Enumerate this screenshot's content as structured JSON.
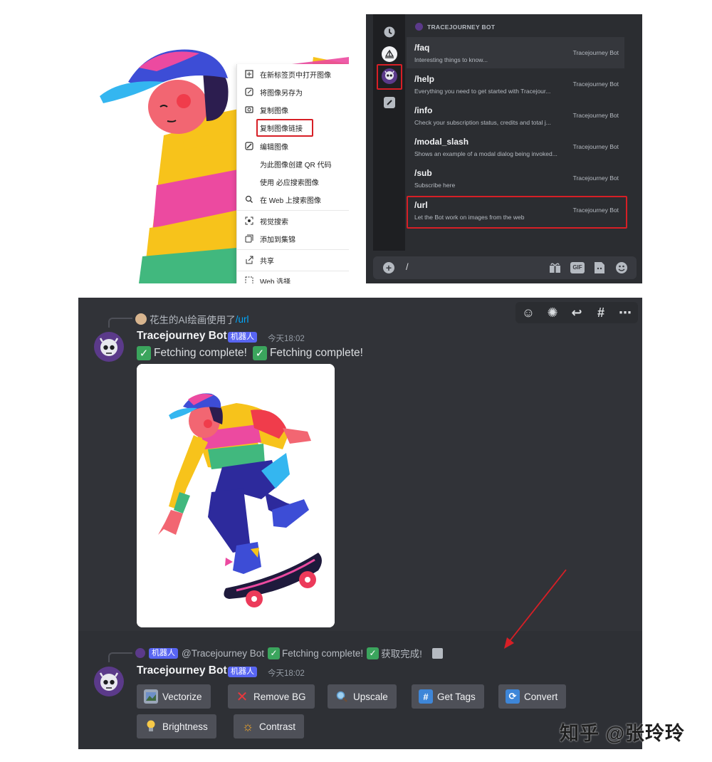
{
  "context_menu": {
    "items": [
      {
        "label": "在新标签页中打开图像",
        "icon": "new-tab-icon"
      },
      {
        "label": "将图像另存为",
        "icon": "save-image-icon"
      },
      {
        "label": "复制图像",
        "icon": "copy-image-icon"
      },
      {
        "label": "复制图像链接",
        "icon": "none",
        "highlighted": true
      },
      {
        "label": "编辑图像",
        "icon": "edit-image-icon"
      },
      {
        "label": "为此图像创建 QR 代码",
        "icon": "none"
      },
      {
        "label": "使用 必应搜索图像",
        "icon": "none"
      },
      {
        "label": "在 Web 上搜索图像",
        "icon": "web-search-icon"
      },
      {
        "label": "视觉搜索",
        "icon": "visual-search-icon"
      },
      {
        "label": "添加到集锦",
        "icon": "collection-icon"
      },
      {
        "label": "共享",
        "icon": "share-icon"
      },
      {
        "label": "Web 选择",
        "icon": "web-select-icon"
      }
    ]
  },
  "command_picker": {
    "header": "TRACEJOURNEY BOT",
    "commands": [
      {
        "name": "/faq",
        "desc": "Interesting things to know...",
        "bot": "Tracejourney Bot"
      },
      {
        "name": "/help",
        "desc": "Everything you need to get started with Tracejour...",
        "bot": "Tracejourney Bot"
      },
      {
        "name": "/info",
        "desc": "Check your subscription status, credits and total j...",
        "bot": "Tracejourney Bot"
      },
      {
        "name": "/modal_slash",
        "desc": "Shows an example of a modal dialog being invoked...",
        "bot": "Tracejourney Bot"
      },
      {
        "name": "/sub",
        "desc": "Subscribe here",
        "bot": "Tracejourney Bot"
      },
      {
        "name": "/url",
        "desc": "Let the Bot work on images from the web",
        "bot": "Tracejourney Bot",
        "highlighted": true
      }
    ],
    "composer_text": "/",
    "composer_icons": [
      "gift-icon",
      "gif-icon",
      "sticker-icon",
      "emoji-icon"
    ],
    "gif_label": "GIF"
  },
  "chat": {
    "message1": {
      "reply_user": "花生的AI绘画使用了",
      "reply_cmd": "/url",
      "username": "Tracejourney Bot",
      "badge": "机器人",
      "timestamp": "今天18:02",
      "text1": "Fetching complete!",
      "text2": "Fetching complete!"
    },
    "message2": {
      "reply_badge": "机器人",
      "reply_user": "@Tracejourney Bot",
      "reply_text1": "Fetching complete!",
      "reply_text2": "获取完成!",
      "username": "Tracejourney Bot",
      "badge": "机器人",
      "timestamp": "今天18:02"
    },
    "buttons": [
      {
        "label": "Vectorize",
        "icon": "vectorize-icon"
      },
      {
        "label": "Remove BG",
        "icon": "cross-icon"
      },
      {
        "label": "Upscale",
        "icon": "magnifier-icon"
      },
      {
        "label": "Get Tags",
        "icon": "hash-icon"
      },
      {
        "label": "Convert",
        "icon": "refresh-icon"
      },
      {
        "label": "Brightness",
        "icon": "bulb-icon"
      },
      {
        "label": "Contrast",
        "icon": "sun-icon"
      }
    ]
  },
  "watermark": "知乎 @张玲玲",
  "colors": {
    "highlight": "#d71f26",
    "discord_blurple": "#5865f2",
    "check_green": "#3ba55d",
    "arrow": "#d71f26"
  }
}
